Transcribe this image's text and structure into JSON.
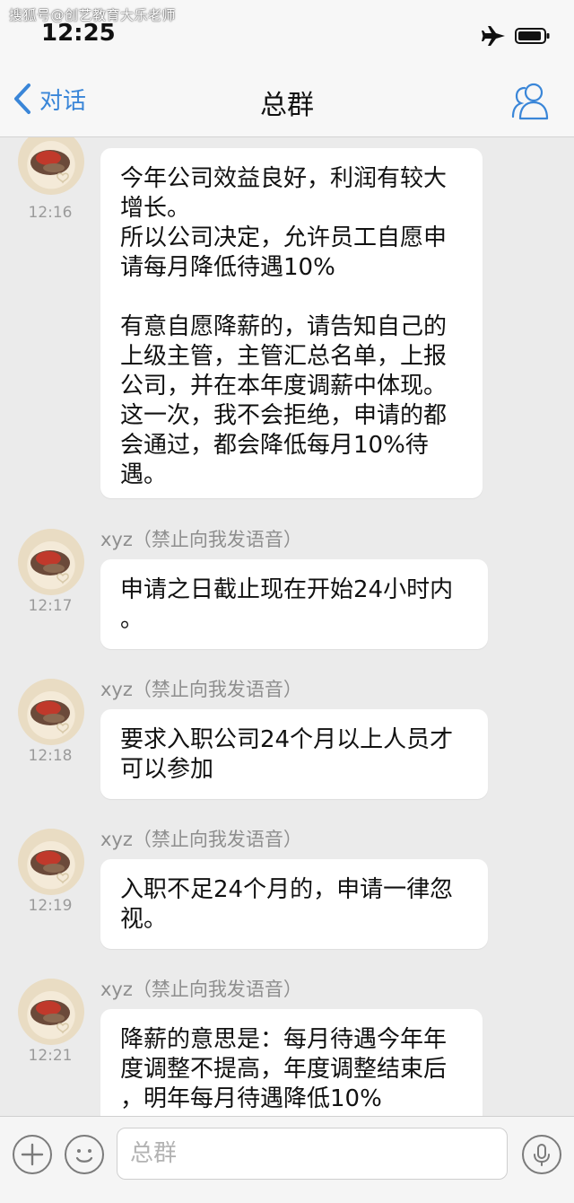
{
  "watermark": "搜狐号@创艺教育大乐老师",
  "status_bar": {
    "time": "12:25"
  },
  "nav": {
    "back_label": "对话",
    "title": "总群"
  },
  "messages": [
    {
      "sender": "",
      "time": "12:16",
      "text": "今年公司效益良好，利润有较大增长。\n所以公司决定，允许员工自愿申请每月降低待遇10%\n\n有意自愿降薪的，请告知自己的上级主管，主管汇总名单，上报公司，并在本年度调薪中体现。这一次，我不会拒绝，申请的都会通过，都会降低每月10%待遇。"
    },
    {
      "sender": "xyz（禁止向我发语音）",
      "time": "12:17",
      "text": "申请之日截止现在开始24小时内\n。"
    },
    {
      "sender": "xyz（禁止向我发语音）",
      "time": "12:18",
      "text": "要求入职公司24个月以上人员才可以参加"
    },
    {
      "sender": "xyz（禁止向我发语音）",
      "time": "12:19",
      "text": "入职不足24个月的，申请一律忽视。"
    },
    {
      "sender": "xyz（禁止向我发语音）",
      "time": "12:21",
      "text": "降薪的意思是：每月待遇今年年度调整不提高，年度调整结束后\n，明年每月待遇降低10%"
    }
  ],
  "input": {
    "placeholder": "总群"
  },
  "icons": {
    "back": "chevron-left-icon",
    "members": "person-icon",
    "add": "plus-icon",
    "emoji": "smiley-icon",
    "voice": "microphone-icon"
  },
  "colors": {
    "accent": "#3a86d8",
    "background": "#ebebeb",
    "bubble": "#ffffff"
  }
}
